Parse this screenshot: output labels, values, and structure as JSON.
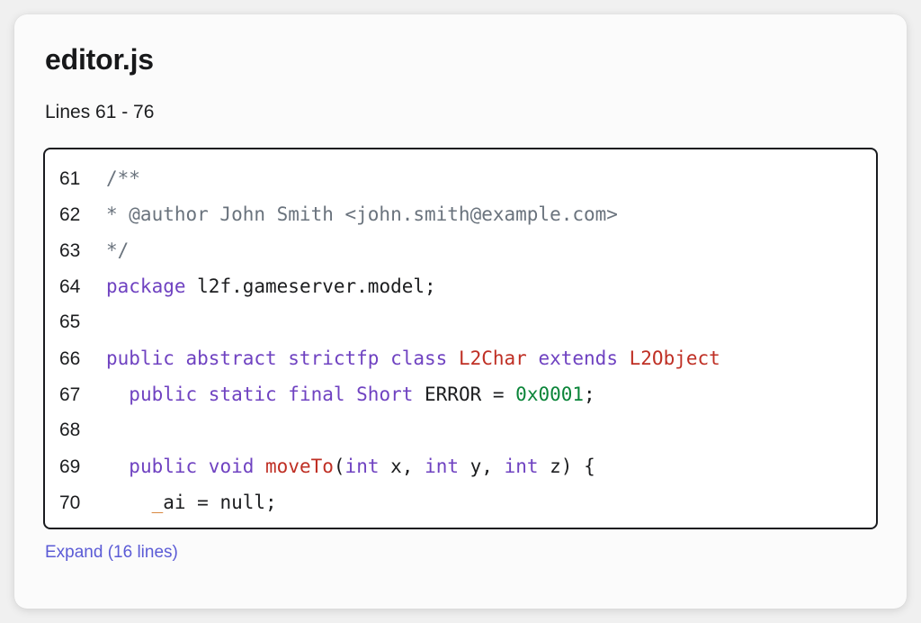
{
  "page": {
    "background_color": "#f0f0f0",
    "card_background_color": "#fbfbfb"
  },
  "header": {
    "file_name": "editor.js",
    "line_range_label": "Lines 61 - 76"
  },
  "colors": {
    "comment": "#6a737d",
    "keyword": "#6f42c1",
    "type": "#bf2f24",
    "function": "#bf2f24",
    "number": "#098438",
    "plain": "#1c1d1f",
    "link": "#5b5bd6",
    "code_border": "#191b1f"
  },
  "code": {
    "lines": [
      {
        "number": "61",
        "tokens": [
          {
            "text": "/**",
            "kind": "comment"
          }
        ]
      },
      {
        "number": "62",
        "tokens": [
          {
            "text": "* @author John Smith <john.smith@example.com>",
            "kind": "comment"
          }
        ]
      },
      {
        "number": "63",
        "tokens": [
          {
            "text": "*/",
            "kind": "comment"
          }
        ]
      },
      {
        "number": "64",
        "tokens": [
          {
            "text": "package",
            "kind": "keyword"
          },
          {
            "text": " l2f.gameserver.model;",
            "kind": "plain"
          }
        ]
      },
      {
        "number": "65",
        "tokens": [
          {
            "text": "",
            "kind": "plain"
          }
        ]
      },
      {
        "number": "66",
        "tokens": [
          {
            "text": "public abstract strictfp class",
            "kind": "keyword"
          },
          {
            "text": " ",
            "kind": "plain"
          },
          {
            "text": "L2Char",
            "kind": "type"
          },
          {
            "text": " ",
            "kind": "plain"
          },
          {
            "text": "extends",
            "kind": "keyword"
          },
          {
            "text": " ",
            "kind": "plain"
          },
          {
            "text": "L2Object",
            "kind": "type"
          }
        ]
      },
      {
        "number": "67",
        "tokens": [
          {
            "text": "  ",
            "kind": "plain"
          },
          {
            "text": "public static final Short",
            "kind": "keyword"
          },
          {
            "text": " ERROR = ",
            "kind": "plain"
          },
          {
            "text": "0x0001",
            "kind": "number"
          },
          {
            "text": ";",
            "kind": "plain"
          }
        ]
      },
      {
        "number": "68",
        "tokens": [
          {
            "text": "",
            "kind": "plain"
          }
        ]
      },
      {
        "number": "69",
        "tokens": [
          {
            "text": "  ",
            "kind": "plain"
          },
          {
            "text": "public void",
            "kind": "keyword"
          },
          {
            "text": " ",
            "kind": "plain"
          },
          {
            "text": "moveTo",
            "kind": "function"
          },
          {
            "text": "(",
            "kind": "plain"
          },
          {
            "text": "int",
            "kind": "keyword"
          },
          {
            "text": " x, ",
            "kind": "plain"
          },
          {
            "text": "int",
            "kind": "keyword"
          },
          {
            "text": " y, ",
            "kind": "plain"
          },
          {
            "text": "int",
            "kind": "keyword"
          },
          {
            "text": " z) {",
            "kind": "plain"
          }
        ]
      },
      {
        "number": "70",
        "tokens": [
          {
            "text": "    ",
            "kind": "plain"
          },
          {
            "text": "_",
            "kind": "underscore"
          },
          {
            "text": "ai = null;",
            "kind": "plain"
          }
        ]
      }
    ]
  },
  "footer": {
    "expand_label": "Expand (16 lines)"
  }
}
